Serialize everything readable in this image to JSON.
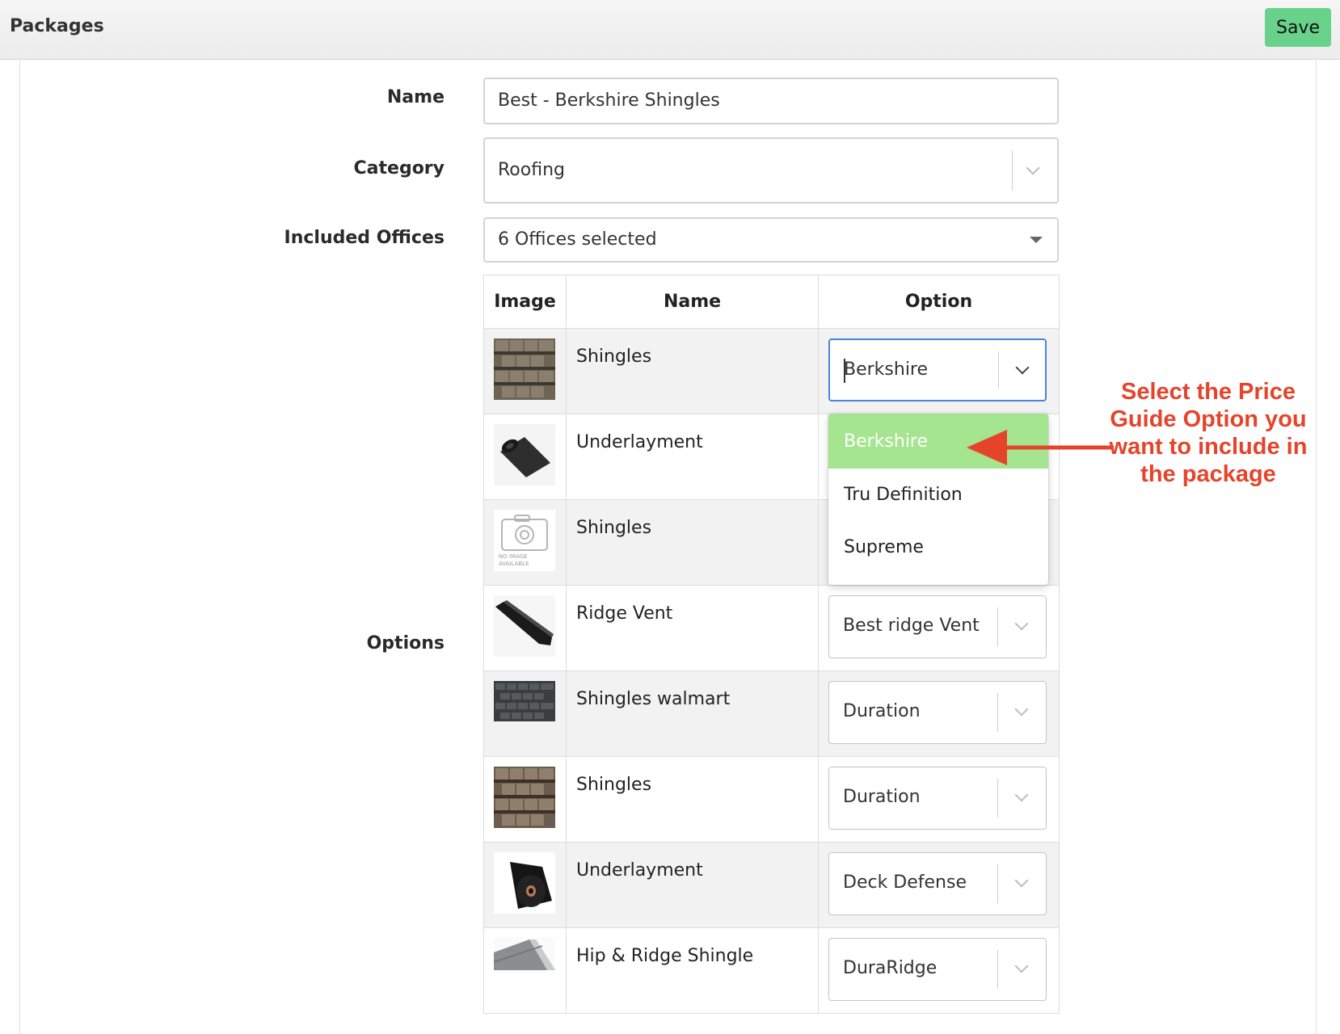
{
  "header": {
    "title": "Packages",
    "save_label": "Save"
  },
  "form": {
    "name_label": "Name",
    "name_value": "Best - Berkshire Shingles",
    "category_label": "Category",
    "category_value": "Roofing",
    "offices_label": "Included Offices",
    "offices_value": "6 Offices selected",
    "options_label": "Options"
  },
  "table": {
    "headers": {
      "image": "Image",
      "name": "Name",
      "option": "Option"
    },
    "rows": [
      {
        "name": "Shingles",
        "option": "Berkshire",
        "image": "shingles-brown-icon"
      },
      {
        "name": "Underlayment",
        "option": "",
        "image": "underlayment-roll-icon"
      },
      {
        "name": "Shingles",
        "option": "",
        "image": "no-image-available-icon",
        "no_image_text": "NO IMAGE AVAILABLE"
      },
      {
        "name": "Ridge Vent",
        "option": "Best ridge Vent",
        "image": "ridge-vent-icon"
      },
      {
        "name": "Shingles walmart",
        "option": "Duration",
        "image": "shingles-dark-icon"
      },
      {
        "name": "Shingles",
        "option": "Duration",
        "image": "shingles-brown-icon"
      },
      {
        "name": "Underlayment",
        "option": "Deck Defense",
        "image": "underlayment-roll-black-icon"
      },
      {
        "name": "Hip & Ridge Shingle",
        "option": "DuraRidge",
        "image": "hip-ridge-icon"
      }
    ]
  },
  "dropdown": {
    "options": [
      "Berkshire",
      "Tru Definition",
      "Supreme"
    ],
    "highlighted": "Berkshire"
  },
  "annotation": {
    "text": "Select the Price Guide Option you want to include in the package",
    "color": "#e5442b"
  },
  "colors": {
    "save_button": "#69d28a",
    "focus_border": "#4a84d8",
    "highlight": "#a5e58f"
  }
}
